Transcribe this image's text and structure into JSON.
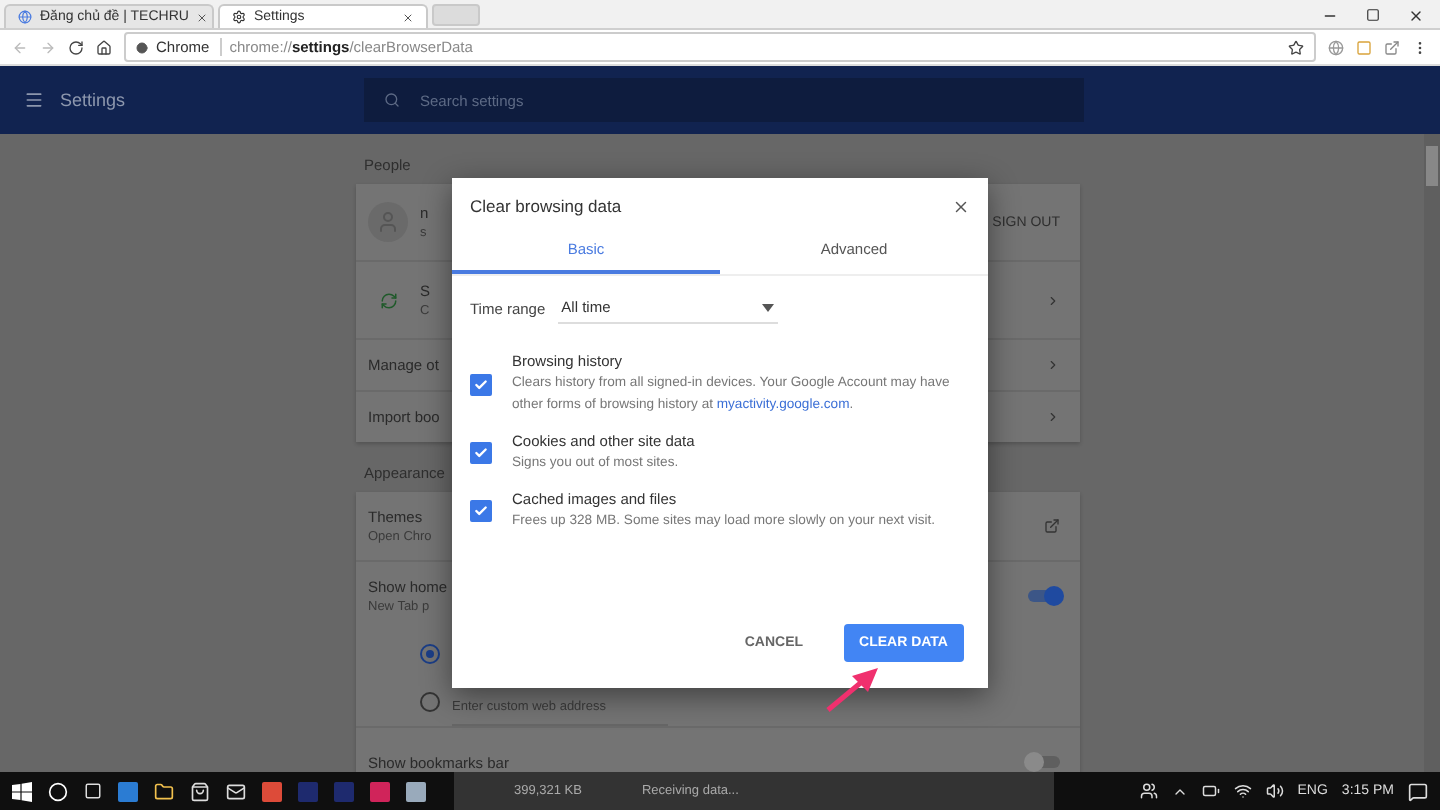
{
  "browser": {
    "tabs": [
      {
        "title": "Đăng chủ đề | TECHRU",
        "selected": false,
        "kind": "web"
      },
      {
        "title": "Settings",
        "selected": true,
        "kind": "settings"
      }
    ],
    "address": {
      "origin": "Chrome",
      "url": "chrome://**settings**/clearBrowserData"
    }
  },
  "header": {
    "title": "Settings",
    "search_placeholder": "Search settings"
  },
  "people": {
    "heading": "People",
    "account_name": "n",
    "account_sub": "s",
    "sign_out": "SIGN OUT",
    "sync_title": "S",
    "sync_sub": "C",
    "rows": [
      "Manage ot",
      "Import boo"
    ]
  },
  "appearance": {
    "heading": "Appearance",
    "themes": "Themes",
    "themes_sub": "Open Chro",
    "home_title": "Show home",
    "home_sub": "New Tab p",
    "home_on": true,
    "radios": [
      {
        "selected": true
      },
      {
        "label": "Enter custom web address",
        "selected": false
      }
    ],
    "bookmarks": "Show bookmarks bar",
    "bookmarks_on": false
  },
  "dialog": {
    "title": "Clear browsing data",
    "tabs": [
      {
        "label": "Basic",
        "selected": true
      },
      {
        "label": "Advanced",
        "selected": false
      }
    ],
    "time_range": {
      "label": "Time range",
      "value": "All time"
    },
    "options": [
      {
        "title": "Browsing history",
        "description": "Clears history from all signed-in devices. Your Google Account may have other forms of browsing history at ",
        "link": "myactivity.google.com",
        "after": ".",
        "checked": true
      },
      {
        "title": "Cookies and other site data",
        "description": "Signs you out of most sites.",
        "checked": true
      },
      {
        "title": "Cached images and files",
        "description": "Frees up 328 MB. Some sites may load more slowly on your next visit.",
        "checked": true
      }
    ],
    "buttons": [
      {
        "label": "CANCEL",
        "kind": "text"
      },
      {
        "label": "CLEAR DATA",
        "kind": "primary"
      }
    ]
  },
  "taskbar": {
    "peek": [
      "399,321 KB",
      "Receiving data..."
    ],
    "language": "ENG",
    "time": "3:15 PM"
  }
}
